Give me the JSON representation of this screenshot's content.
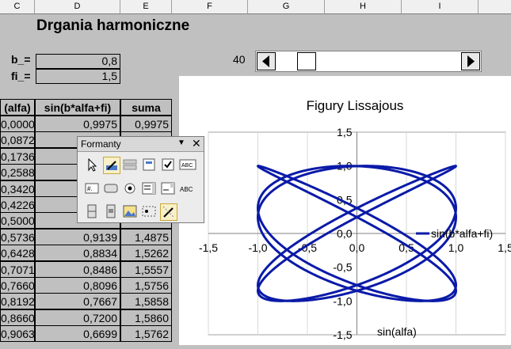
{
  "columns": [
    "C",
    "D",
    "E",
    "F",
    "G",
    "H",
    "I"
  ],
  "title": "Drgania harmoniczne",
  "params": [
    {
      "label": "b_=",
      "value": "0,8"
    },
    {
      "label": "fi_=",
      "value": "1,5"
    }
  ],
  "slider": {
    "value": "40"
  },
  "table": {
    "headers": [
      "(alfa)",
      "sin(b*alfa+fi)",
      "suma"
    ],
    "rows": [
      [
        "0,0000",
        "0,9975",
        "0,9975"
      ],
      [
        "0,0872",
        "",
        ""
      ],
      [
        "0,1736",
        "",
        ""
      ],
      [
        "0,2588",
        "",
        ""
      ],
      [
        "0,3420",
        "",
        ""
      ],
      [
        "0,4226",
        "",
        ""
      ],
      [
        "0,5000",
        "",
        ""
      ],
      [
        "0,5736",
        "0,9139",
        "1,4875"
      ],
      [
        "0,6428",
        "0,8834",
        "1,5262"
      ],
      [
        "0,7071",
        "0,8486",
        "1,5557"
      ],
      [
        "0,7660",
        "0,8096",
        "1,5756"
      ],
      [
        "0,8192",
        "0,7667",
        "1,5858"
      ],
      [
        "0,8660",
        "0,7200",
        "1,5860"
      ],
      [
        "0,9063",
        "0,6699",
        "1,5762"
      ]
    ]
  },
  "toolbar": {
    "title": "Formanty",
    "menu_icon": "dropdown-arrow-icon",
    "close_icon": "close-icon"
  },
  "chart_data": {
    "type": "scatter",
    "title": "Figury Lissajous",
    "xlabel": "sin(alfa)",
    "series": [
      {
        "name": "sin(b*alfa+fi)",
        "b": 0.8,
        "fi": 1.5
      }
    ],
    "xlim": [
      -1.5,
      1.5
    ],
    "ylim": [
      -1.5,
      1.5
    ],
    "xticks": [
      "-1,5",
      "-1,0",
      "-0,5",
      "0,0",
      "0,5",
      "1,0",
      "1,5"
    ],
    "yticks": [
      "1,5",
      "1,0",
      "0,5",
      "0,0",
      "-0,5",
      "-1,0",
      "-1,5"
    ],
    "color": "#0a1aa8"
  }
}
